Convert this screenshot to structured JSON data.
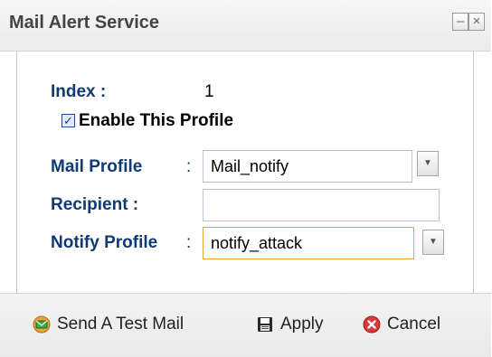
{
  "dialog": {
    "title": "Mail Alert Service",
    "minimize_glyph": "–",
    "close_glyph": "×"
  },
  "form": {
    "index_label": "Index :",
    "index_value": "1",
    "enable_label": "Enable This Profile",
    "enable_checked": true,
    "mail_profile_label": "Mail Profile",
    "mail_profile_sep": ":",
    "mail_profile_value": "Mail_notify",
    "recipient_label": "Recipient :",
    "recipient_value": "",
    "notify_profile_label": "Notify Profile",
    "notify_profile_sep": ":",
    "notify_profile_value": "notify_attack"
  },
  "footer": {
    "send_test_label": "Send A Test Mail",
    "apply_label": "Apply",
    "cancel_label": "Cancel"
  },
  "icons": {
    "send": "mail-send-icon",
    "apply": "floppy-disk-icon",
    "cancel": "cancel-circle-icon"
  },
  "colors": {
    "label_blue": "#0f3a74",
    "focus_orange": "#e7a33a"
  }
}
